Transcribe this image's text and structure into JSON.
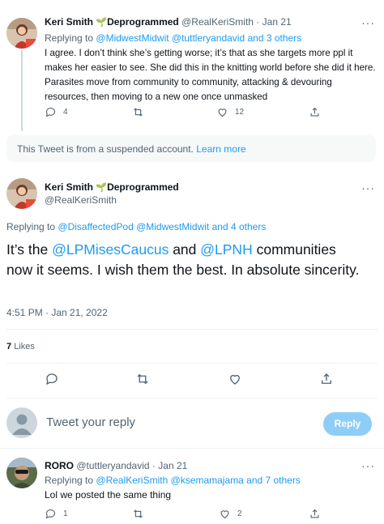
{
  "tweet1": {
    "author_name": "Keri Smith",
    "badge_emoji": "🌱",
    "badge_text": "Deprogrammed",
    "handle": "@RealKeriSmith",
    "date": "Jan 21",
    "replying_label": "Replying to",
    "replying_to": "@MidwestMidwit @tuttleryandavid and 3 others",
    "text": "I agree. I don’t think she’s getting worse; it’s that as she targets more ppl it makes her easier to see. She did this in the knitting world before she did it here. Parasites move from community to community, attacking & devouring resources, then moving to a new one once unmasked",
    "reply_count": "4",
    "retweet_count": "",
    "like_count": "12"
  },
  "suspended": {
    "text": "This Tweet is from a suspended account.",
    "link": "Learn more"
  },
  "main_tweet": {
    "author_name": "Keri Smith",
    "badge_emoji": "🌱",
    "badge_text": "Deprogrammed",
    "handle": "@RealKeriSmith",
    "replying_label": "Replying to",
    "replying_to": "@DisaffectedPod @MidwestMidwit and 4 others",
    "text_part1": "It’s the ",
    "mention1": "@LPMisesCaucus",
    "text_part2": " and ",
    "mention2": "@LPNH",
    "text_part3": " communities now it seems. I wish them the best. In absolute sincerity.",
    "timestamp": "4:51 PM · Jan 21, 2022",
    "likes_count": "7",
    "likes_label": "Likes"
  },
  "compose": {
    "placeholder": "Tweet your reply",
    "button": "Reply"
  },
  "tweet3": {
    "author_name": "RORO",
    "handle": "@tuttleryandavid",
    "date": "Jan 21",
    "replying_label": "Replying to",
    "replying_to": "@RealKeriSmith @ksemamajama and 7 others",
    "text": "Lol we posted the same thing",
    "reply_count": "1",
    "like_count": "2"
  },
  "colors": {
    "accent": "#1d9bf0",
    "muted": "#536471",
    "reply_button_disabled": "#8ecdf8",
    "suspended_bg": "#f7f9f9"
  }
}
